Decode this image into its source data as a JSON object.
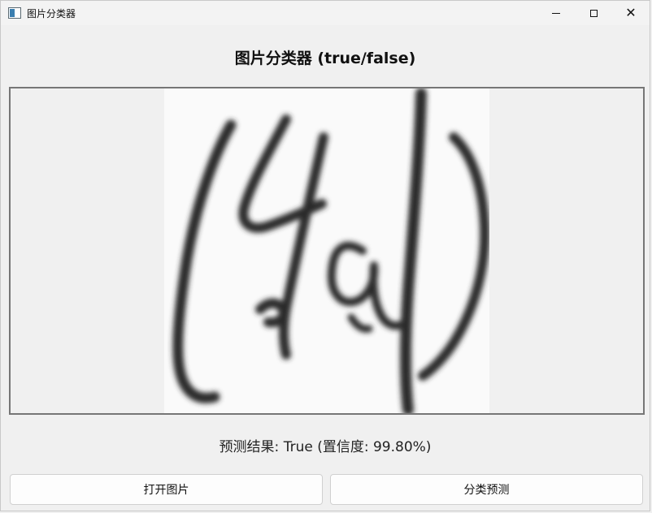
{
  "window": {
    "title": "图片分类器"
  },
  "heading": "图片分类器 (true/false)",
  "result_text": "预测结果: True (置信度: 99.80%)",
  "buttons": {
    "open_label": "打开图片",
    "predict_label": "分类预测"
  },
  "image": {
    "description_icon": "handwriting-image"
  }
}
